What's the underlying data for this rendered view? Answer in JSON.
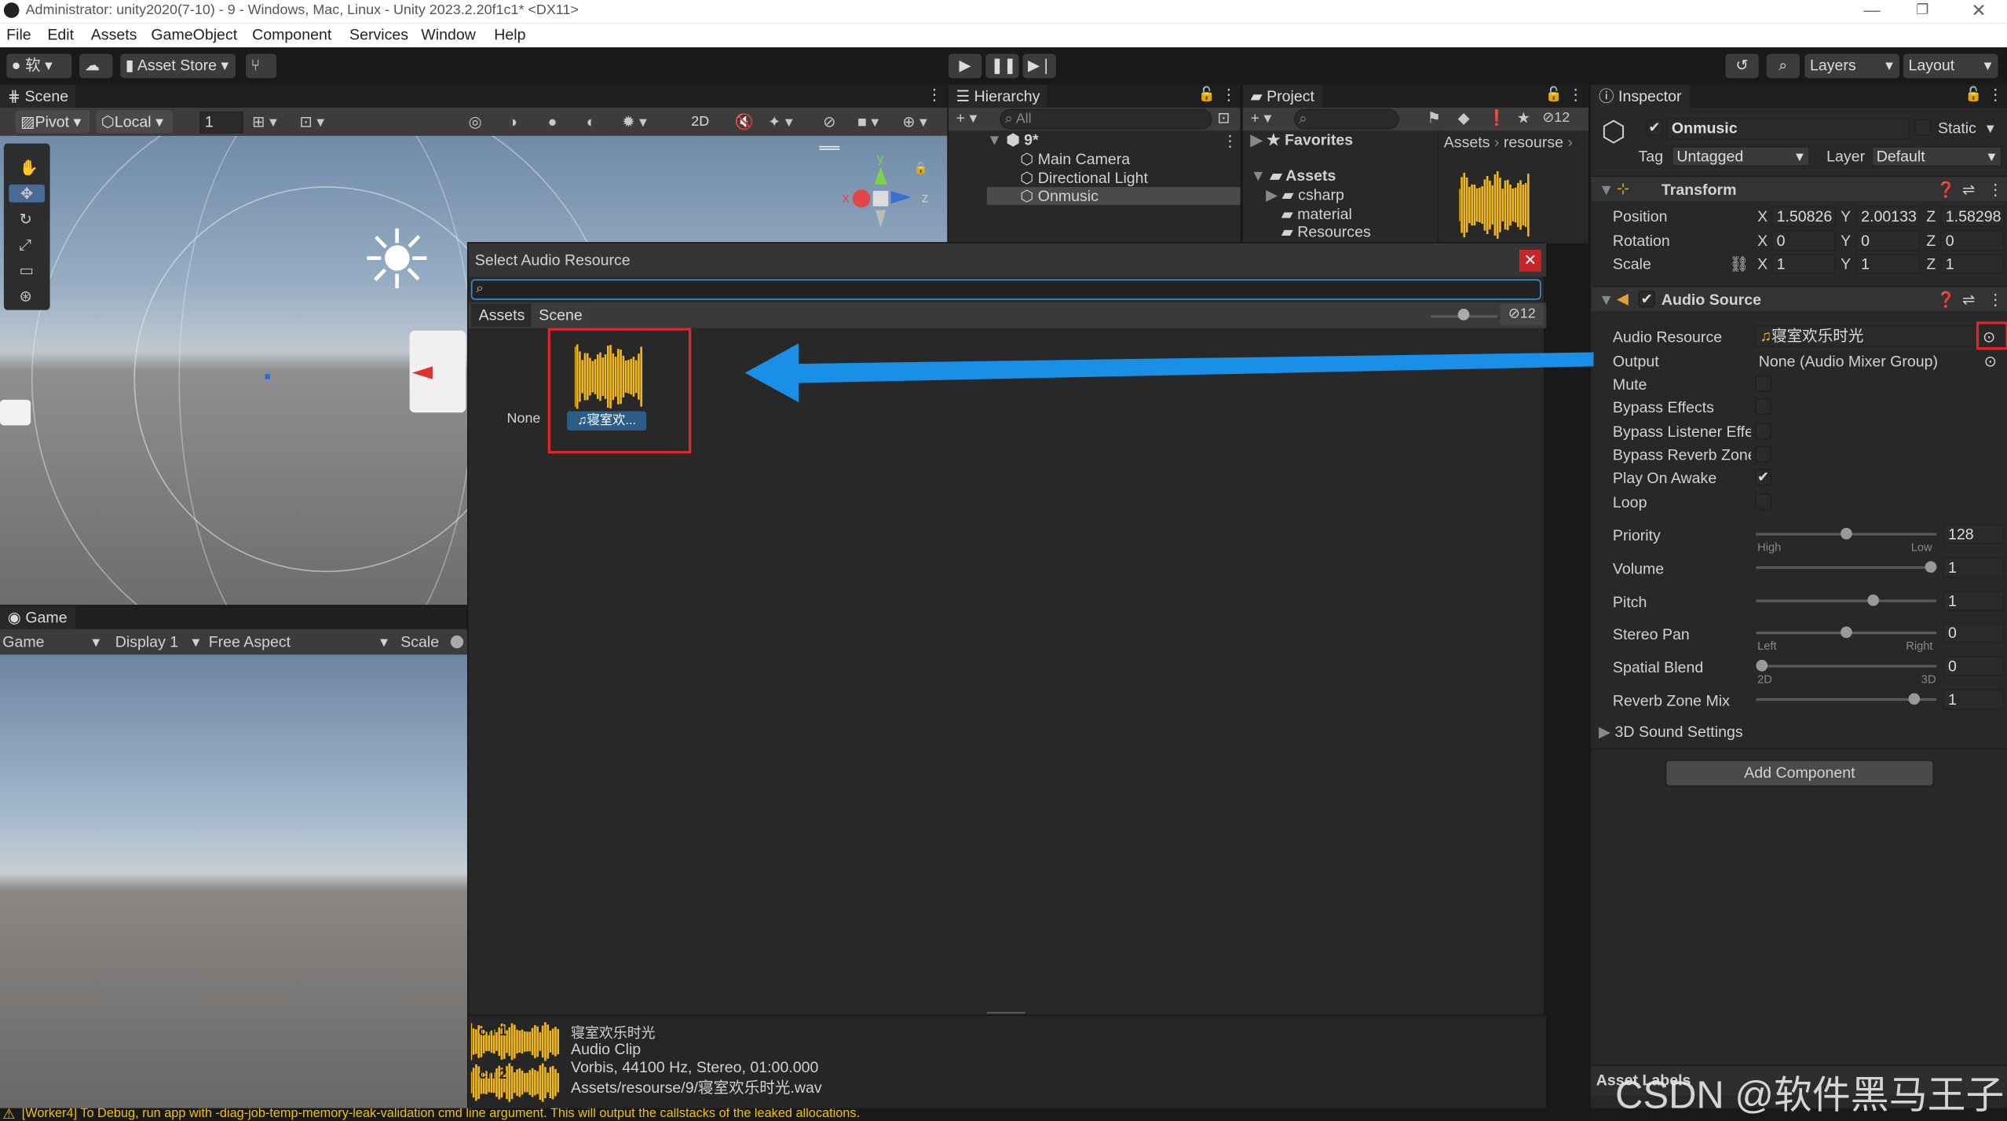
{
  "window": {
    "title": "Administrator: unity2020(7-10) - 9 - Windows, Mac, Linux - Unity 2023.2.20f1c1* <DX11>"
  },
  "menu": [
    "File",
    "Edit",
    "Assets",
    "GameObject",
    "Component",
    "Services",
    "Window",
    "Help"
  ],
  "toolbar": {
    "account": "软",
    "asset_store": "Asset Store",
    "layers": "Layers",
    "layout": "Layout"
  },
  "scene": {
    "tab": "Scene",
    "pivot": "Pivot",
    "local": "Local",
    "grid_value": "1",
    "mode_2d": "2D",
    "gizmo_x": "x",
    "gizmo_y": "y",
    "gizmo_z": "z"
  },
  "game": {
    "tab": "Game",
    "game_dropdown": "Game",
    "display": "Display 1",
    "aspect": "Free Aspect",
    "scale": "Scale"
  },
  "hierarchy": {
    "tab": "Hierarchy",
    "search_placeholder": "All",
    "scene_name": "9*",
    "items": [
      "Main Camera",
      "Directional Light",
      "Onmusic"
    ]
  },
  "project": {
    "tab": "Project",
    "favorites": "Favorites",
    "assets_root": "Assets",
    "folders": [
      "csharp",
      "material",
      "Resources"
    ],
    "breadcrumb": [
      "Assets",
      "resourse"
    ],
    "hidden_count": "12"
  },
  "inspector": {
    "tab": "Inspector",
    "object_name": "Onmusic",
    "static_label": "Static",
    "tag_label": "Tag",
    "tag_value": "Untagged",
    "layer_label": "Layer",
    "layer_value": "Default",
    "transform": {
      "title": "Transform",
      "position_label": "Position",
      "position": [
        "1.50826",
        "2.00133",
        "1.58298"
      ],
      "rotation_label": "Rotation",
      "rotation": [
        "0",
        "0",
        "0"
      ],
      "scale_label": "Scale",
      "scale": [
        "1",
        "1",
        "1"
      ]
    },
    "audio_source": {
      "title": "Audio Source",
      "resource_label": "Audio Resource",
      "resource_value": "寝室欢乐时光",
      "output_label": "Output",
      "output_value": "None (Audio Mixer Group)",
      "mute_label": "Mute",
      "bypass_effects_label": "Bypass Effects",
      "bypass_listener_label": "Bypass Listener Effe",
      "bypass_reverb_label": "Bypass Reverb Zone:",
      "play_on_awake_label": "Play On Awake",
      "play_on_awake": true,
      "loop_label": "Loop",
      "priority_label": "Priority",
      "priority": "128",
      "priority_high": "High",
      "priority_low": "Low",
      "priority_fraction": 0.5,
      "volume_label": "Volume",
      "volume": "1",
      "volume_fraction": 1.0,
      "pitch_label": "Pitch",
      "pitch": "1",
      "pitch_fraction": 0.66,
      "stereo_pan_label": "Stereo Pan",
      "stereo_pan": "0",
      "pan_left": "Left",
      "pan_right": "Right",
      "stereo_pan_fraction": 0.5,
      "spatial_blend_label": "Spatial Blend",
      "spatial_blend": "0",
      "blend_2d": "2D",
      "blend_3d": "3D",
      "spatial_blend_fraction": 0.0,
      "reverb_mix_label": "Reverb Zone Mix",
      "reverb_mix": "1",
      "reverb_mix_fraction": 0.9,
      "sound_3d_label": "3D Sound Settings"
    },
    "add_component": "Add Component",
    "asset_labels": "Asset Labels"
  },
  "dialog": {
    "title": "Select Audio Resource",
    "tabs": [
      "Assets",
      "Scene"
    ],
    "hidden_count": "12",
    "none_label": "None",
    "item_label": "寝室欢...",
    "preview": {
      "channel1": "ch 1",
      "channel2": "ch 2",
      "name": "寝室欢乐时光",
      "type": "Audio Clip",
      "format": "Vorbis, 44100 Hz, Stereo, 01:00.000",
      "path": "Assets/resourse/9/寝室欢乐时光.wav"
    }
  },
  "status": {
    "message": "[Worker4] To Debug, run app with -diag-job-temp-memory-leak-validation cmd line argument. This will output the callstacks of the leaked allocations."
  },
  "watermark": "CSDN @软件黑马王子",
  "colors": {
    "arrow": "#1a8fe8",
    "highlight": "#e0252c",
    "waveform": "#f0b81e",
    "warning": "#f5c000"
  }
}
